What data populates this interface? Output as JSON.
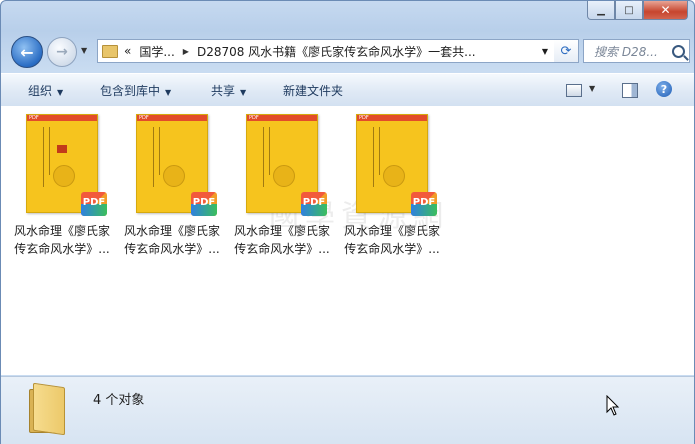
{
  "window": {
    "minimize_icon": "minimize-icon",
    "maximize_icon": "maximize-icon",
    "close_icon": "close-icon"
  },
  "address": {
    "overflow": "«",
    "crumbs": [
      "国学...",
      "D28708 风水书籍《廖氏家传玄命风水学》一套共..."
    ]
  },
  "search": {
    "placeholder": "搜索 D28..."
  },
  "toolbar": {
    "organize": "组织",
    "include_library": "包含到库中",
    "share": "共享",
    "new_folder": "新建文件夹"
  },
  "files": [
    {
      "line1": "风水命理《廖氏家",
      "line2": "传玄命风水学》..."
    },
    {
      "line1": "风水命理《廖氏家",
      "line2": "传玄命风水学》..."
    },
    {
      "line1": "风水命理《廖氏家",
      "line2": "传玄命风水学》..."
    },
    {
      "line1": "风水命理《廖氏家",
      "line2": "传玄命风水学》..."
    }
  ],
  "file_badge": "PDF",
  "watermark": "國學資源網",
  "status": {
    "count": "4 个对象"
  },
  "colors": {
    "thumb_yellow": "#f6c41e",
    "accent_blue": "#2a6dc4"
  }
}
